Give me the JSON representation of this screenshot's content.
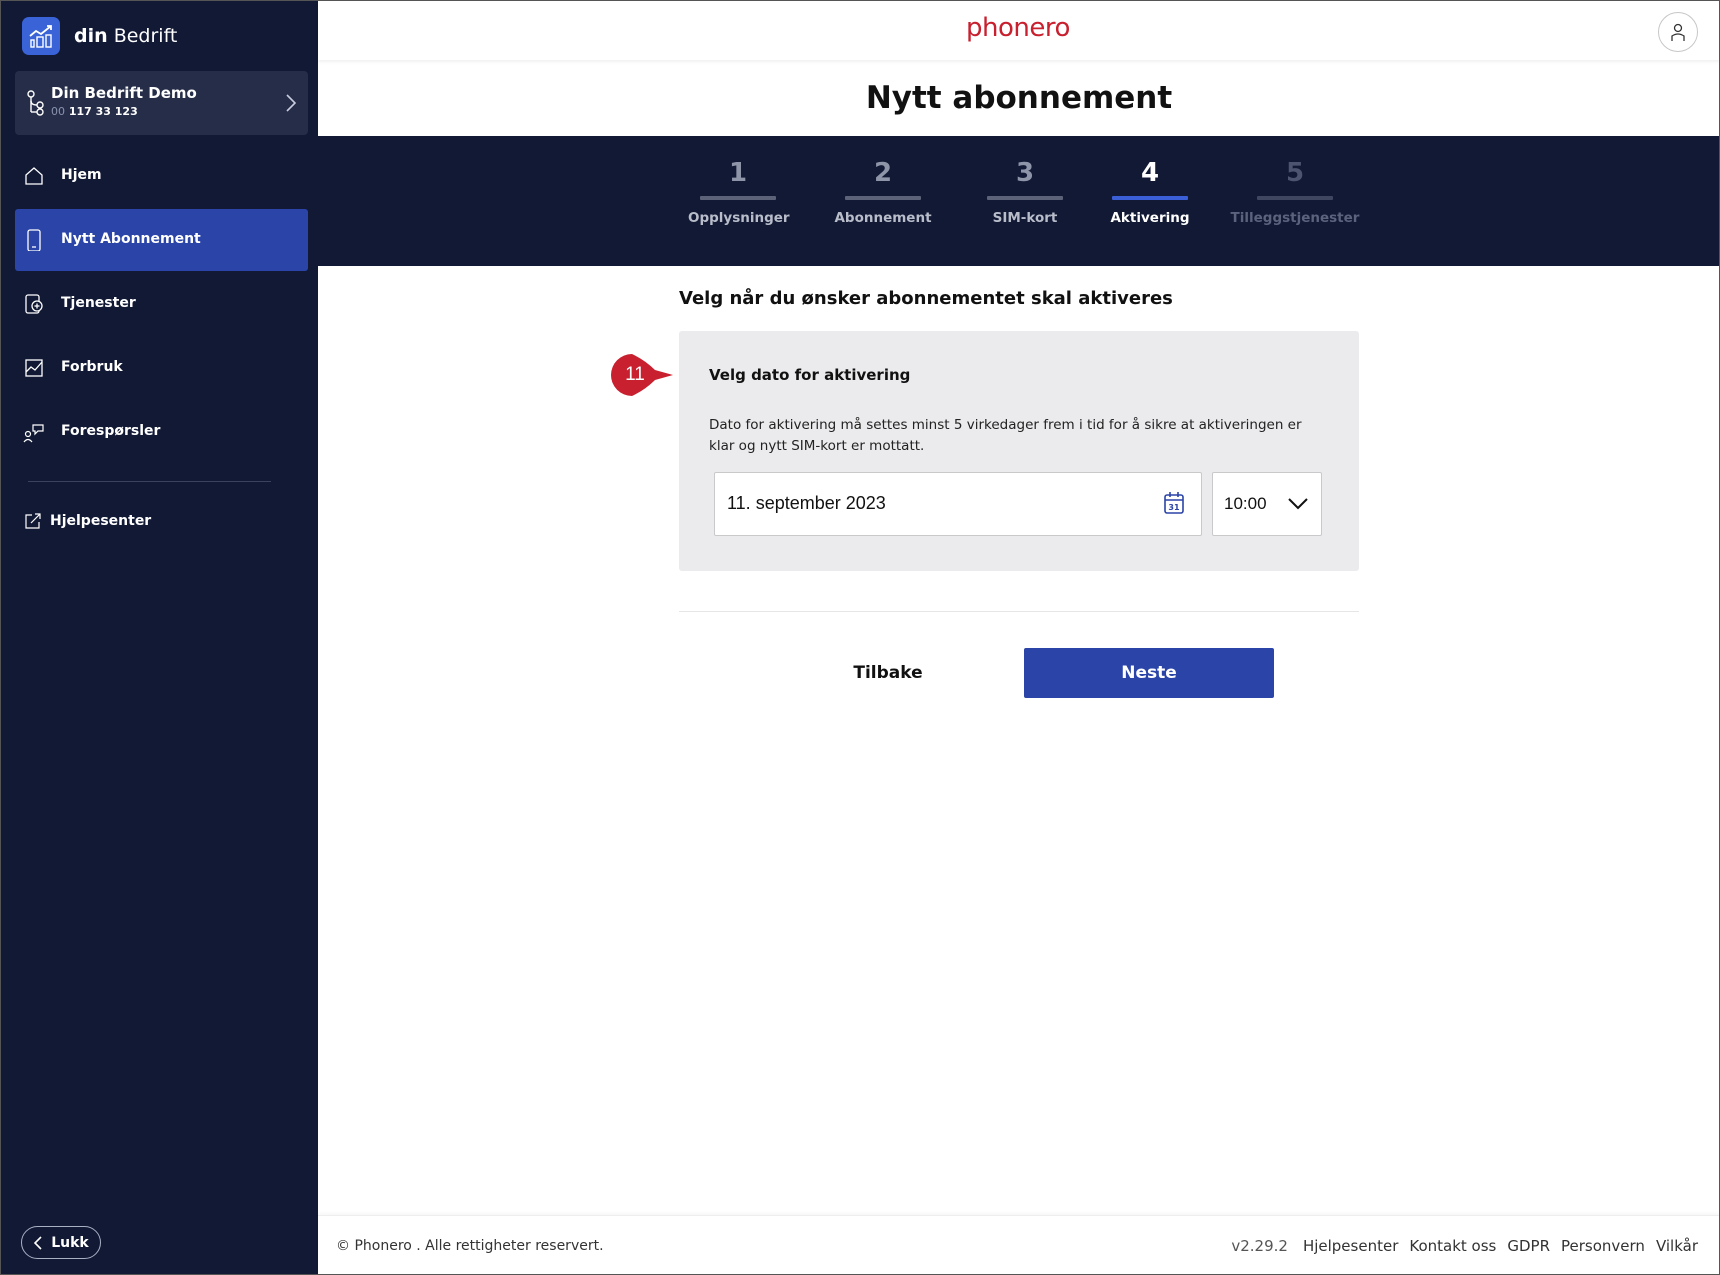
{
  "sidebar": {
    "brand": {
      "prefix": "din",
      "name": "Bedrift"
    },
    "company": {
      "name": "Din Bedrift Demo",
      "number_prefix": "00",
      "number": "117 33 123"
    },
    "nav": [
      {
        "label": "Hjem",
        "icon": "home-icon"
      },
      {
        "label": "Nytt Abonnement",
        "icon": "phone-icon",
        "active": true
      },
      {
        "label": "Tjenester",
        "icon": "services-icon"
      },
      {
        "label": "Forbruk",
        "icon": "usage-chart-icon"
      },
      {
        "label": "Forespørsler",
        "icon": "chat-icon"
      }
    ],
    "help": "Hjelpesenter",
    "close": "Lukk"
  },
  "header": {
    "logo": "phonero",
    "title": "Nytt abonnement"
  },
  "steps": [
    {
      "num": "1",
      "label": "Opplysninger",
      "state": "done"
    },
    {
      "num": "2",
      "label": "Abonnement",
      "state": "done"
    },
    {
      "num": "3",
      "label": "SIM-kort",
      "state": "done"
    },
    {
      "num": "4",
      "label": "Aktivering",
      "state": "current"
    },
    {
      "num": "5",
      "label": "Tilleggstjenester",
      "state": "future"
    }
  ],
  "activation": {
    "heading": "Velg når du ønsker abonnementet skal aktiveres",
    "card_title": "Velg dato for aktivering",
    "description": "Dato for aktivering må settes minst 5 virkedager frem i tid for å sikre at aktiveringen er klar og nytt SIM-kort er mottatt.",
    "date_value": "11. september 2023",
    "time_value": "10:00",
    "callout": "11"
  },
  "actions": {
    "back": "Tilbake",
    "next": "Neste"
  },
  "footer": {
    "copyright": "© Phonero . Alle rettigheter reservert.",
    "version": "v2.29.2",
    "links": [
      "Hjelpesenter",
      "Kontakt oss",
      "GDPR",
      "Personvern",
      "Vilkår"
    ]
  },
  "colors": {
    "sidebar_bg": "#111935",
    "accent": "#2b44a8",
    "brand_red": "#c8202f",
    "callout_red": "#c8202f"
  }
}
